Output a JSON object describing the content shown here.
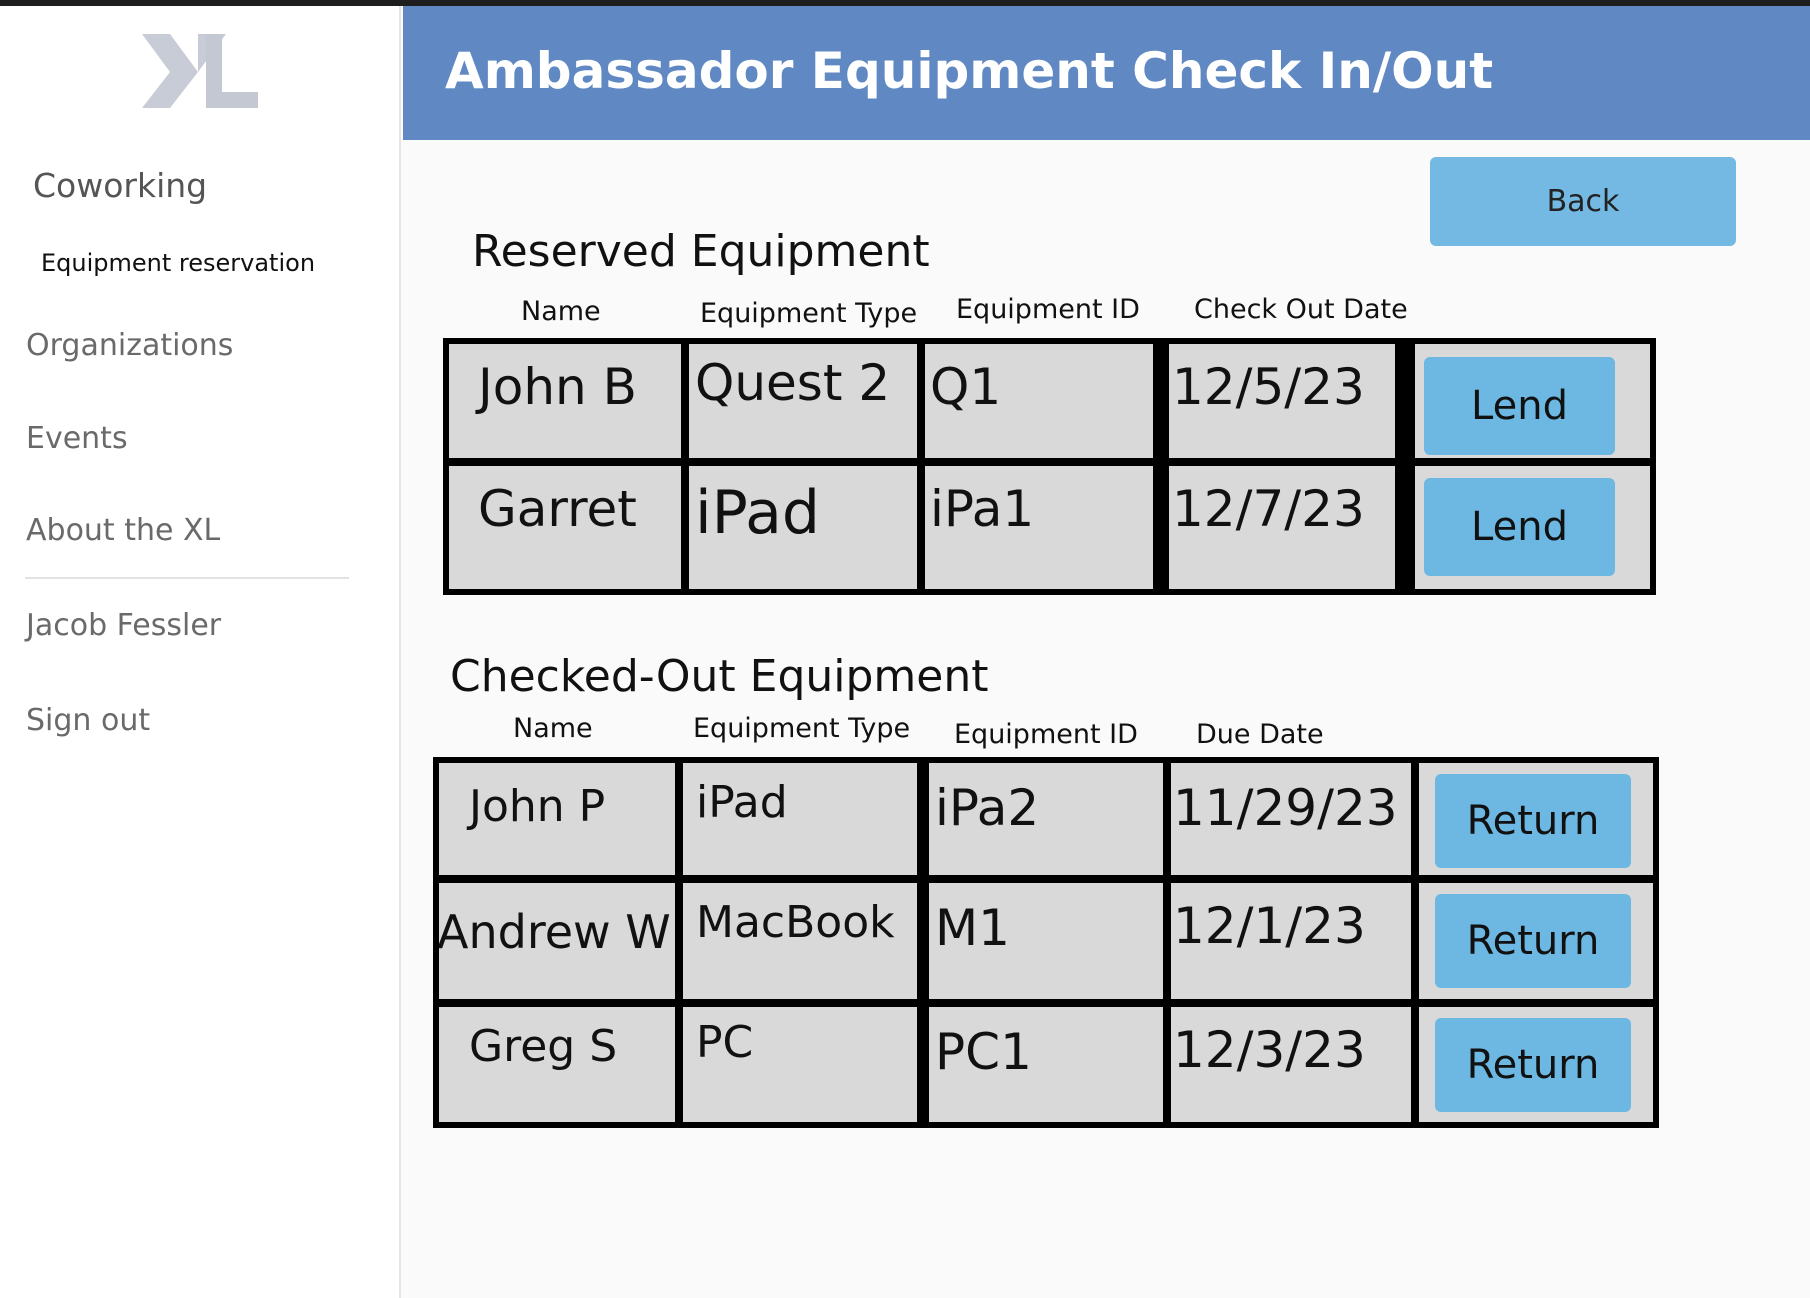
{
  "sidebar": {
    "nav": {
      "coworking": "Coworking",
      "equipment_reservation": "Equipment reservation",
      "organizations": "Organizations",
      "events": "Events",
      "about": "About the XL",
      "user": "Jacob Fessler",
      "sign_out": "Sign out"
    }
  },
  "header": {
    "title": "Ambassador Equipment Check In/Out"
  },
  "back_label": "Back",
  "reserved": {
    "title": "Reserved Equipment",
    "columns": [
      "Name",
      "Equipment Type",
      "Equipment ID",
      "Check Out Date"
    ],
    "action_label": "Lend",
    "rows": [
      {
        "name": "John B",
        "type": "Quest 2",
        "id": "Q1",
        "date": "12/5/23"
      },
      {
        "name": "Garret",
        "type": "iPad",
        "id": "iPa1",
        "date": "12/7/23"
      }
    ]
  },
  "checked_out": {
    "title": "Checked-Out Equipment",
    "columns": [
      "Name",
      "Equipment Type",
      "Equipment ID",
      "Due Date"
    ],
    "action_label": "Return",
    "rows": [
      {
        "name": "John P",
        "type": "iPad",
        "id": "iPa2",
        "date": "11/29/23"
      },
      {
        "name": "Andrew W",
        "type": "MacBook",
        "id": "M1",
        "date": "12/1/23"
      },
      {
        "name": "Greg S",
        "type": "PC",
        "id": "PC1",
        "date": "12/3/23"
      }
    ]
  },
  "colors": {
    "header": "#6088c2",
    "button": "#6cb8e2",
    "cell": "#d9d9d9"
  }
}
